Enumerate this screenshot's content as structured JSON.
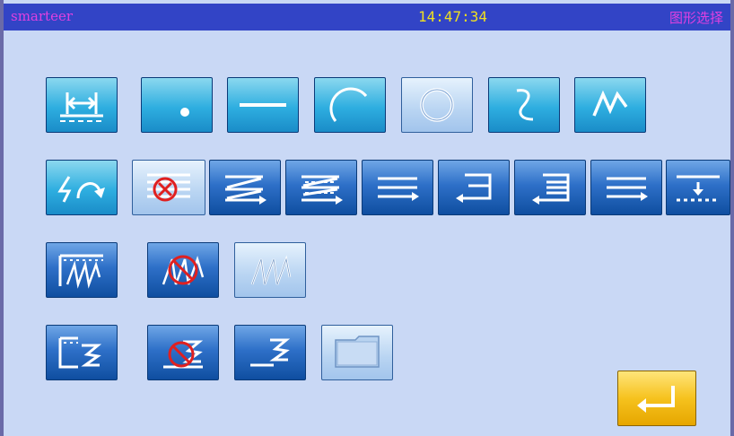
{
  "header": {
    "brand": "smarteer",
    "time": "14:47:34",
    "screen_title": "图形选择"
  },
  "colors": {
    "header_bg": "#3244c6",
    "brand_text": "#e040e0",
    "time_text": "#f0e020",
    "page_bg": "#c9d8f5",
    "button_cyan": "#2eaee0",
    "button_blue": "#2e70c8",
    "confirm_yellow": "#f6c21e"
  },
  "rows": {
    "shapes": [
      "measure-icon",
      "point-icon",
      "straight-line-icon",
      "arc-icon",
      "circle-icon",
      "curve-icon",
      "zigzag-icon"
    ],
    "sewing": [
      "seam-reverse-icon",
      "no-reinforce-icon",
      "reinforce-start-icon",
      "reinforce-double-icon",
      "multi-line-icon",
      "return-left-icon",
      "return-multi-icon",
      "parallel-lines-icon",
      "end-marker-icon"
    ],
    "zigzag": [
      "zigzag-set-icon",
      "zigzag-cancel-icon",
      "zigzag-select-icon"
    ],
    "step": [
      "step-set-icon",
      "step-cancel-icon",
      "step-icon",
      "folder-icon"
    ]
  }
}
